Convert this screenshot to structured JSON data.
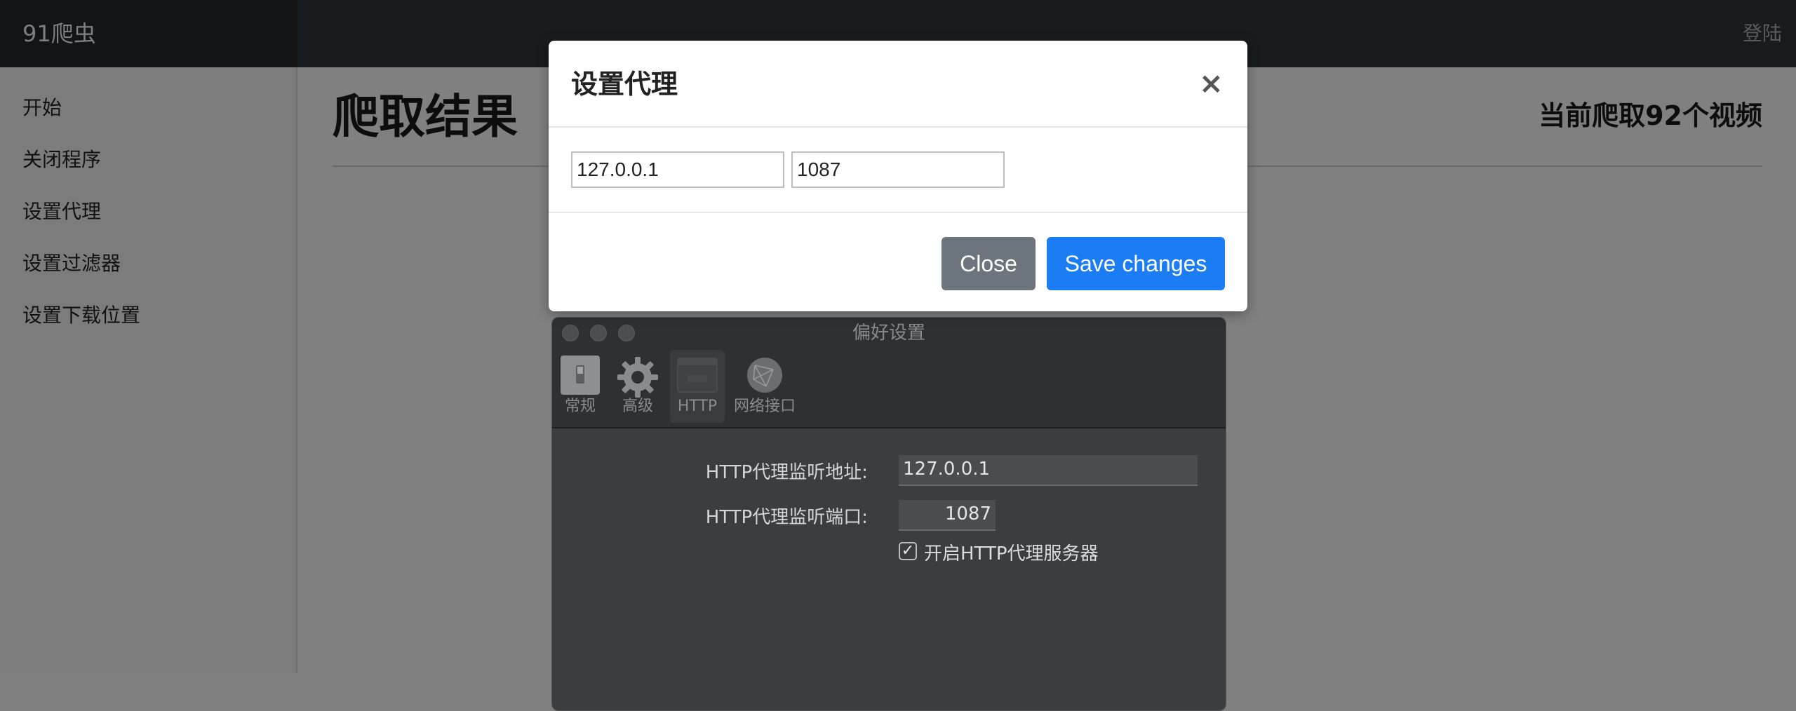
{
  "navbar": {
    "brand": "91爬虫",
    "login": "登陆"
  },
  "sidebar": {
    "items": [
      {
        "label": "开始"
      },
      {
        "label": "关闭程序"
      },
      {
        "label": "设置代理"
      },
      {
        "label": "设置过滤器"
      },
      {
        "label": "设置下载位置"
      }
    ]
  },
  "main": {
    "title": "爬取结果",
    "status": "当前爬取92个视频"
  },
  "modal": {
    "title": "设置代理",
    "close_symbol": "×",
    "host_value": "127.0.0.1",
    "port_value": "1087",
    "close_label": "Close",
    "save_label": "Save changes"
  },
  "prefs": {
    "window_title": "偏好设置",
    "tabs": [
      {
        "label": "常规",
        "icon": "switch-icon"
      },
      {
        "label": "高级",
        "icon": "gear-icon"
      },
      {
        "label": "HTTP",
        "icon": "browser-window-icon"
      },
      {
        "label": "网络接口",
        "icon": "globe-icon"
      }
    ],
    "active_tab": "HTTP",
    "address_label": "HTTP代理监听地址:",
    "address_value": "127.0.0.1",
    "port_label": "HTTP代理监听端口:",
    "port_value": "1087",
    "enable_checked": true,
    "enable_label": "开启HTTP代理服务器",
    "check_mark": "✓"
  }
}
